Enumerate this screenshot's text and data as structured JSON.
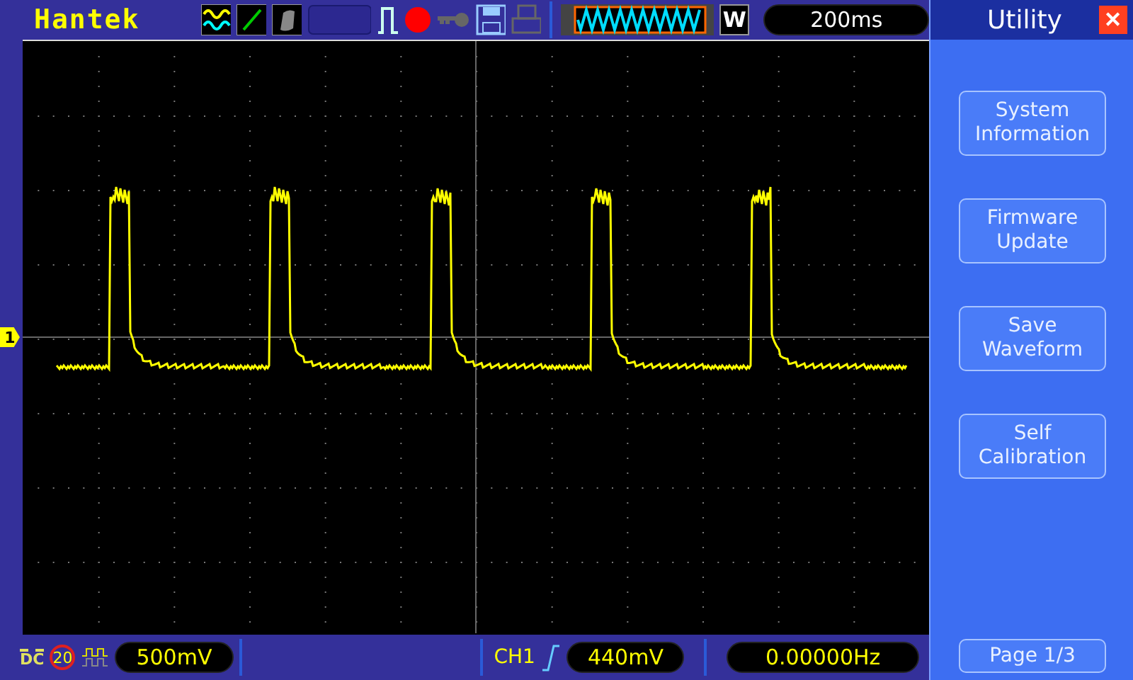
{
  "top_bar": {
    "brand": "Hantek",
    "window_mark": "W",
    "timebase": "200ms"
  },
  "channel_marker": "1",
  "menu": {
    "title": "Utility",
    "close": "✕",
    "buttons": [
      {
        "label": "System\nInformation"
      },
      {
        "label": "Firmware\nUpdate"
      },
      {
        "label": "Save\nWaveform"
      },
      {
        "label": "Self\nCalibration"
      }
    ],
    "page": "Page 1/3"
  },
  "bottom_bar": {
    "coupling": "DC",
    "bandwidth_limit": "20",
    "volts_per_div": "500mV",
    "trigger_source": "CH1",
    "trigger_level": "440mV",
    "frequency": "0.00000Hz"
  }
}
